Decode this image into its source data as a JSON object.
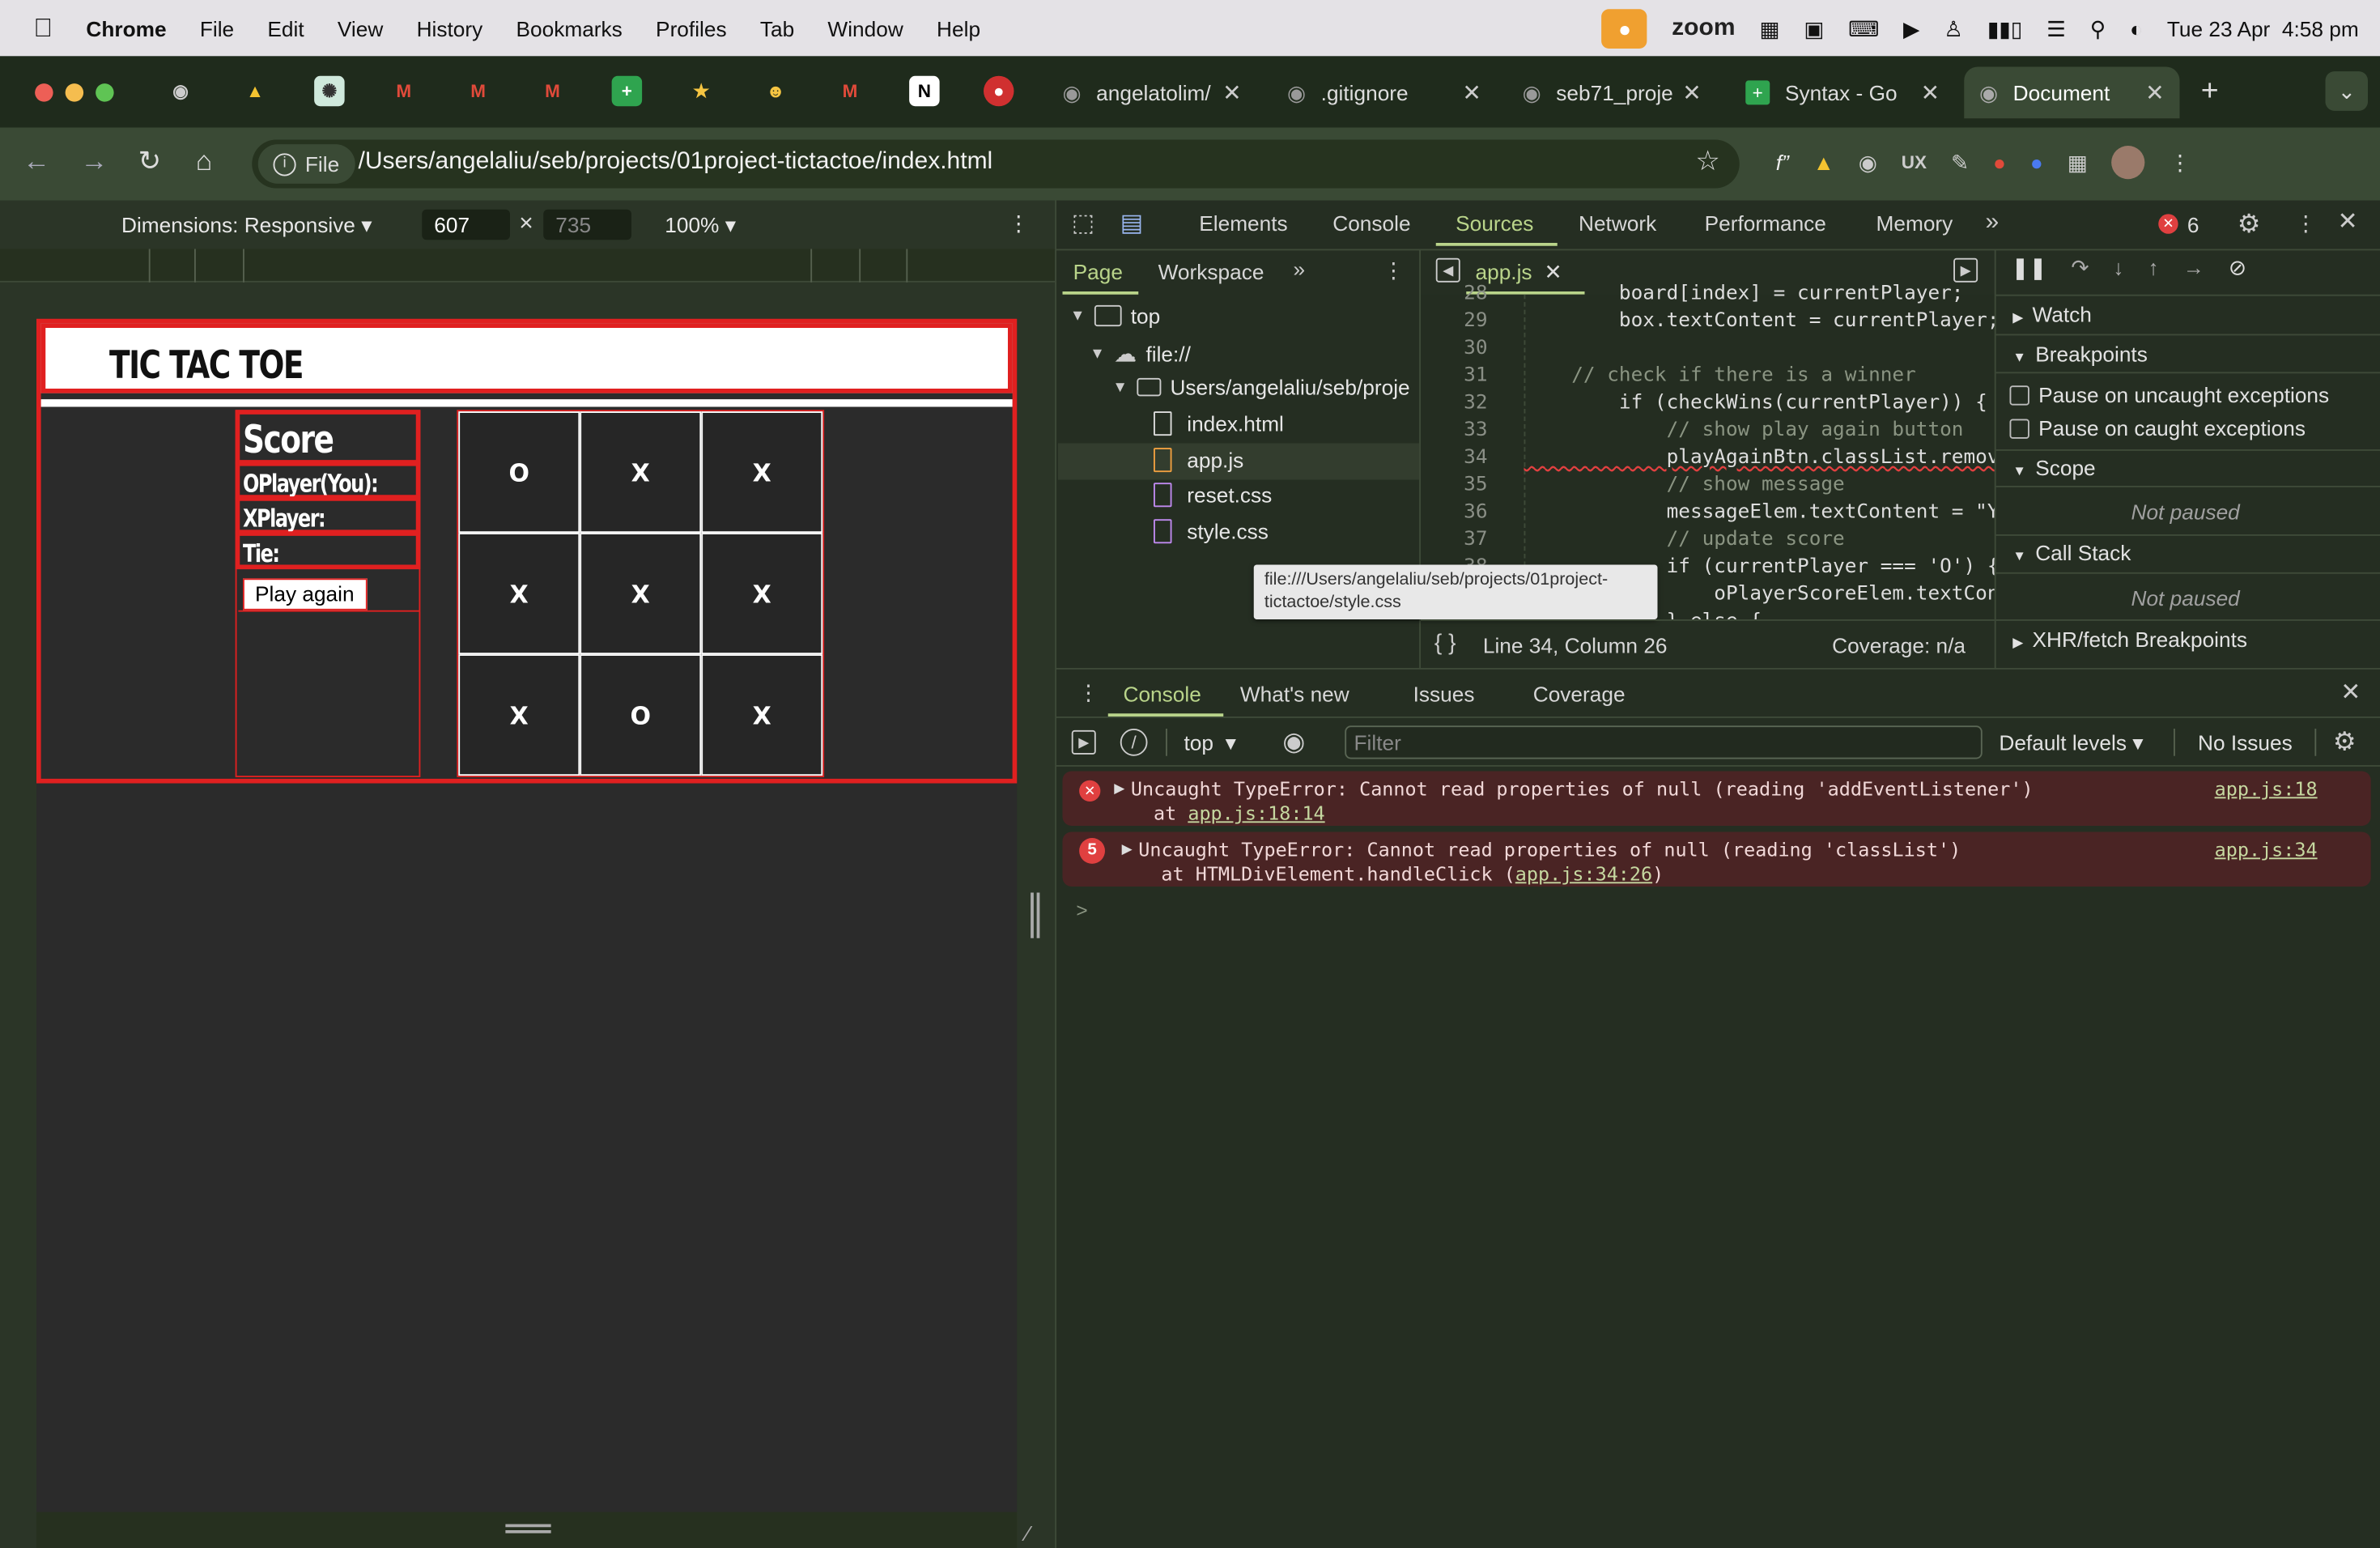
{
  "menubar": {
    "app": "Chrome",
    "items": [
      "File",
      "Edit",
      "View",
      "History",
      "Bookmarks",
      "Profiles",
      "Tab",
      "Window",
      "Help"
    ],
    "zoom": "zoom",
    "datetime": "Tue 23 Apr  4:58 pm"
  },
  "tabs": [
    {
      "label": "angelatolim/"
    },
    {
      "label": ".gitignore"
    },
    {
      "label": "seb71_proje"
    },
    {
      "label": "Syntax - Go"
    },
    {
      "label": "Document"
    }
  ],
  "address": {
    "scheme_label": "File",
    "url": "/Users/angelaliu/seb/projects/01project-tictactoe/index.html"
  },
  "device_toolbar": {
    "dimensions_label": "Dimensions: Responsive",
    "width": "607",
    "times": "×",
    "height": "735",
    "zoom": "100%"
  },
  "page": {
    "title": "TIC TAC TOE",
    "score_heading": "Score",
    "o_player": "OPlayer(You):",
    "x_player": "XPlayer:",
    "tie": "Tie:",
    "play_again": "Play again",
    "board": [
      "O",
      "X",
      "X",
      "X",
      "X",
      "X",
      "X",
      "O",
      "X"
    ]
  },
  "devtools": {
    "main_tabs": [
      "Elements",
      "Console",
      "Sources",
      "Network",
      "Performance",
      "Memory"
    ],
    "active_tab": "Sources",
    "error_count": "6",
    "nav_tabs": [
      "Page",
      "Workspace"
    ],
    "tree": {
      "top": "top",
      "origin": "file://",
      "folder": "Users/angelaliu/seb/proje",
      "files": [
        "index.html",
        "app.js",
        "reset.css",
        "style.css"
      ]
    },
    "open_file": "app.js",
    "tooltip": "file:///Users/angelaliu/seb/projects/01project-tictactoe/style.css",
    "code_lines": [
      {
        "n": "28",
        "t": "        board[index] = currentPlayer;"
      },
      {
        "n": "29",
        "t": "        box.textContent = currentPlayer;"
      },
      {
        "n": "30",
        "t": ""
      },
      {
        "n": "31",
        "t": "    // check if there is a winner"
      },
      {
        "n": "32",
        "t": "        if (checkWins(currentPlayer)) {"
      },
      {
        "n": "33",
        "t": "            // show play again button"
      },
      {
        "n": "34",
        "t": "            playAgainBtn.classList.remove"
      },
      {
        "n": "35",
        "t": "            // show message"
      },
      {
        "n": "36",
        "t": "            messageElem.textContent = \"Y"
      },
      {
        "n": "37",
        "t": "            // update score"
      },
      {
        "n": "38",
        "t": "            if (currentPlayer === 'O') {"
      },
      {
        "n": "39",
        "t": "                oPlayerScoreElem.textCon"
      },
      {
        "n": "40",
        "t": "            } else {"
      }
    ],
    "status": {
      "position": "Line 34, Column 26",
      "coverage": "Coverage: n/a"
    },
    "debugger": {
      "watch": "Watch",
      "breakpoints": "Breakpoints",
      "pause_uncaught": "Pause on uncaught exceptions",
      "pause_caught": "Pause on caught exceptions",
      "scope": "Scope",
      "not_paused": "Not paused",
      "call_stack": "Call Stack",
      "not_paused_2": "Not paused",
      "xhr": "XHR/fetch Breakpoints"
    },
    "drawer": {
      "tabs": [
        "Console",
        "What's new",
        "Issues",
        "Coverage"
      ],
      "context": "top",
      "filter_placeholder": "Filter",
      "levels": "Default levels",
      "issues": "No Issues",
      "errors": [
        {
          "count": "",
          "msg": "Uncaught TypeError: Cannot read properties of null (reading 'addEventListener')",
          "at_prefix": "at ",
          "at_link": "app.js:18:14",
          "at_suffix": "",
          "src": "app.js:18"
        },
        {
          "count": "5",
          "msg": "Uncaught TypeError: Cannot read properties of null (reading 'classList')",
          "at_prefix": "at HTMLDivElement.handleClick (",
          "at_link": "app.js:34:26",
          "at_suffix": ")",
          "src": "app.js:34"
        }
      ],
      "prompt": ">"
    }
  }
}
